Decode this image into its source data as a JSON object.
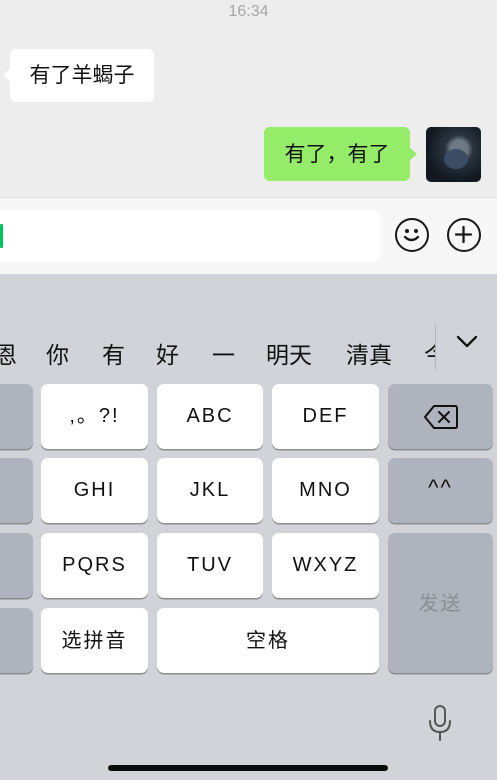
{
  "status": {
    "time": "16:34"
  },
  "chat": {
    "messages": [
      {
        "side": "left",
        "text": "有了羊蝎子"
      },
      {
        "side": "right",
        "text": "有了，有了"
      }
    ]
  },
  "input": {
    "value": ""
  },
  "keyboard": {
    "candidates": [
      "恩",
      "你",
      "有",
      "好",
      "一",
      "明天",
      "清真",
      "今"
    ],
    "keys": {
      "punct": ",。?!",
      "abc": "ABC",
      "def": "DEF",
      "ghi": "GHI",
      "jkl": "JKL",
      "mno": "MNO",
      "pqrs": "PQRS",
      "tuv": "TUV",
      "wxyz": "WXYZ",
      "pinyin": "选拼音",
      "space": "空格",
      "emoticon": "^^",
      "send": "发送"
    }
  },
  "colors": {
    "sent_bubble": "#95ec69",
    "keyboard_bg": "#d1d3d9"
  },
  "icons": [
    "emoji-icon",
    "plus-icon",
    "backspace-icon",
    "chevron-down-icon",
    "microphone-icon"
  ]
}
